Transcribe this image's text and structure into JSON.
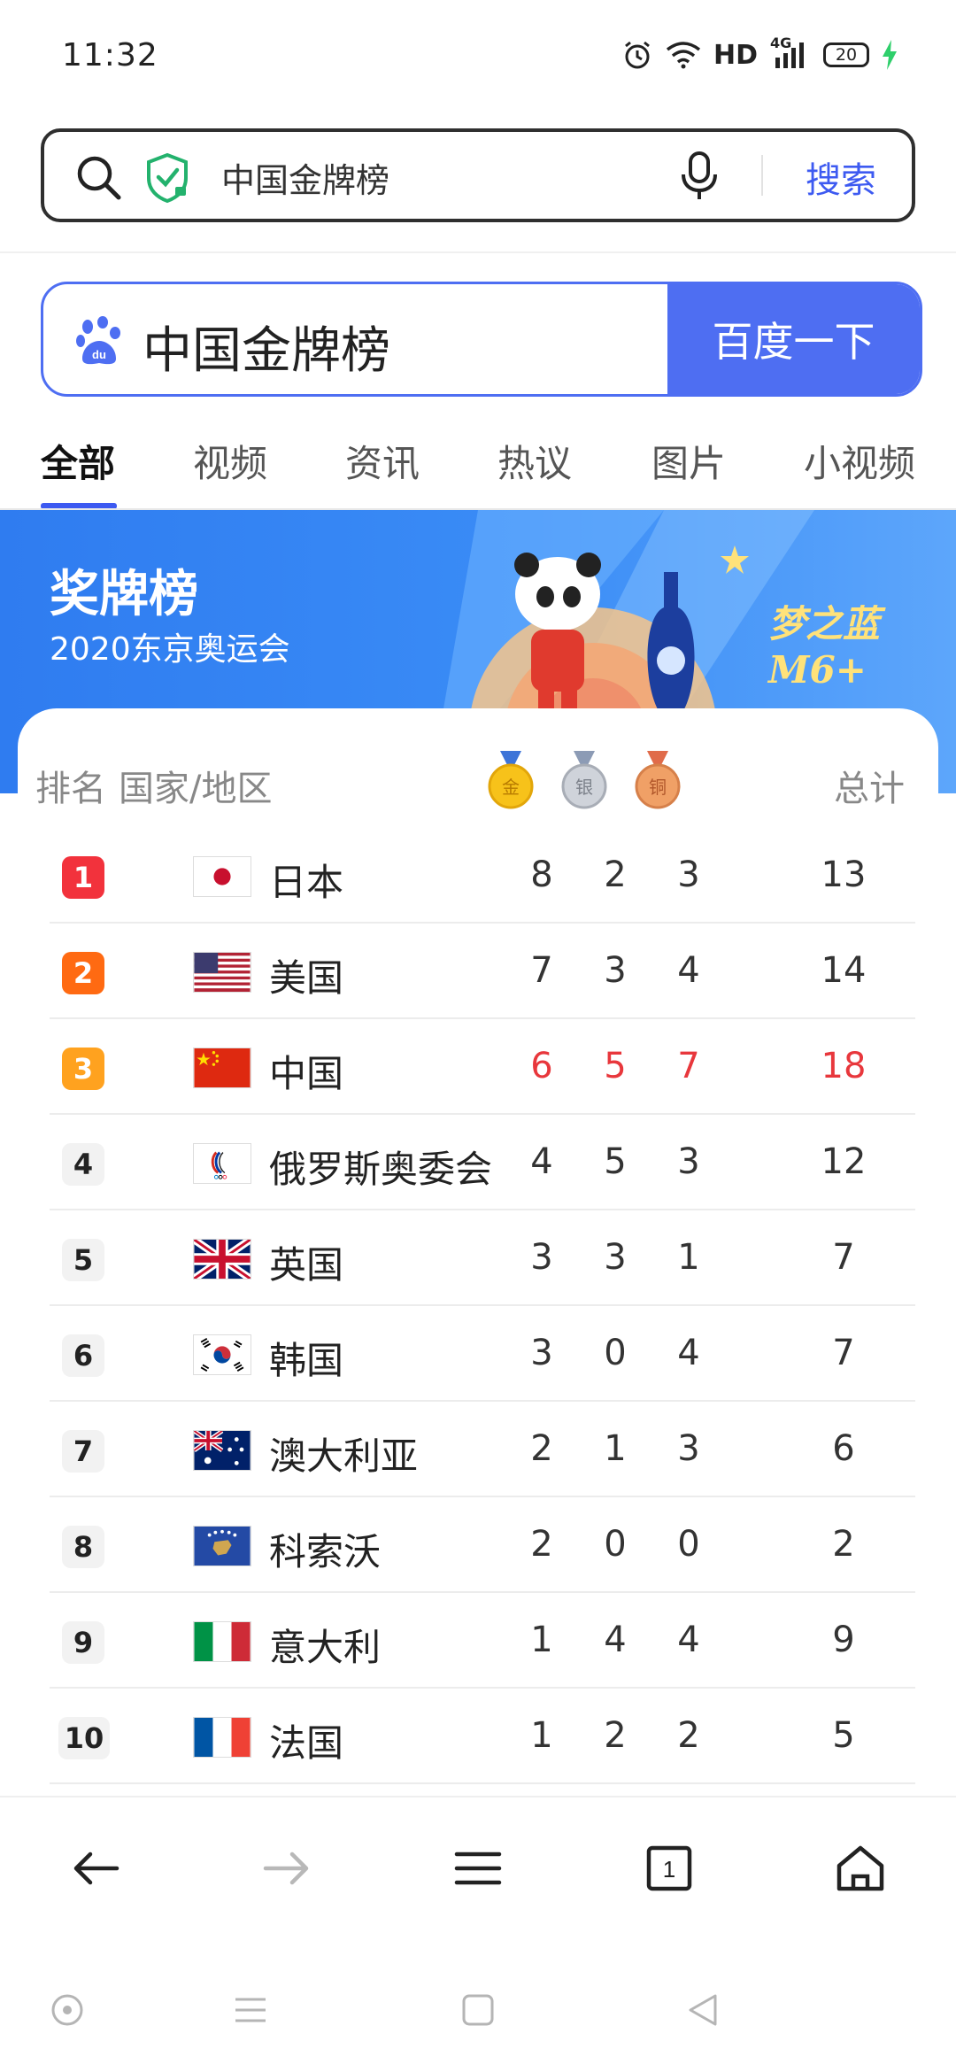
{
  "status_bar": {
    "time": "11:32",
    "network_label": "HD",
    "signal_label": "4G",
    "battery": "20"
  },
  "address_bar": {
    "query": "中国金牌榜",
    "search_label": "搜索"
  },
  "baidu": {
    "query": "中国金牌榜",
    "button_label": "百度一下"
  },
  "tabs": [
    {
      "label": "全部",
      "active": true
    },
    {
      "label": "视频"
    },
    {
      "label": "资讯"
    },
    {
      "label": "热议"
    },
    {
      "label": "图片"
    },
    {
      "label": "小视频"
    }
  ],
  "banner": {
    "title": "奖牌榜",
    "subtitle": "2020东京奥运会",
    "brand": "梦之蓝 M6+"
  },
  "table": {
    "headers": {
      "rank": "排名",
      "country": "国家/地区",
      "gold": "金",
      "silver": "银",
      "bronze": "铜",
      "total": "总计"
    },
    "rows": [
      {
        "rank": "1",
        "country": "日本",
        "gold": "8",
        "silver": "2",
        "bronze": "3",
        "total": "13",
        "flag": "japan-flag"
      },
      {
        "rank": "2",
        "country": "美国",
        "gold": "7",
        "silver": "3",
        "bronze": "4",
        "total": "14",
        "flag": "usa-flag"
      },
      {
        "rank": "3",
        "country": "中国",
        "gold": "6",
        "silver": "5",
        "bronze": "7",
        "total": "18",
        "flag": "china-flag",
        "highlight": true
      },
      {
        "rank": "4",
        "country": "俄罗斯奥委会",
        "gold": "4",
        "silver": "5",
        "bronze": "3",
        "total": "12",
        "flag": "roc-flag"
      },
      {
        "rank": "5",
        "country": "英国",
        "gold": "3",
        "silver": "3",
        "bronze": "1",
        "total": "7",
        "flag": "uk-flag"
      },
      {
        "rank": "6",
        "country": "韩国",
        "gold": "3",
        "silver": "0",
        "bronze": "4",
        "total": "7",
        "flag": "korea-flag"
      },
      {
        "rank": "7",
        "country": "澳大利亚",
        "gold": "2",
        "silver": "1",
        "bronze": "3",
        "total": "6",
        "flag": "australia-flag"
      },
      {
        "rank": "8",
        "country": "科索沃",
        "gold": "2",
        "silver": "0",
        "bronze": "0",
        "total": "2",
        "flag": "kosovo-flag"
      },
      {
        "rank": "9",
        "country": "意大利",
        "gold": "1",
        "silver": "4",
        "bronze": "4",
        "total": "9",
        "flag": "italy-flag"
      },
      {
        "rank": "10",
        "country": "法国",
        "gold": "1",
        "silver": "2",
        "bronze": "2",
        "total": "5",
        "flag": "france-flag"
      }
    ]
  },
  "bottom_nav": {
    "tab_count": "1"
  },
  "colors": {
    "accent": "#4e6ef2",
    "highlight": "#e8373c",
    "banner": "#3a8cf6"
  }
}
